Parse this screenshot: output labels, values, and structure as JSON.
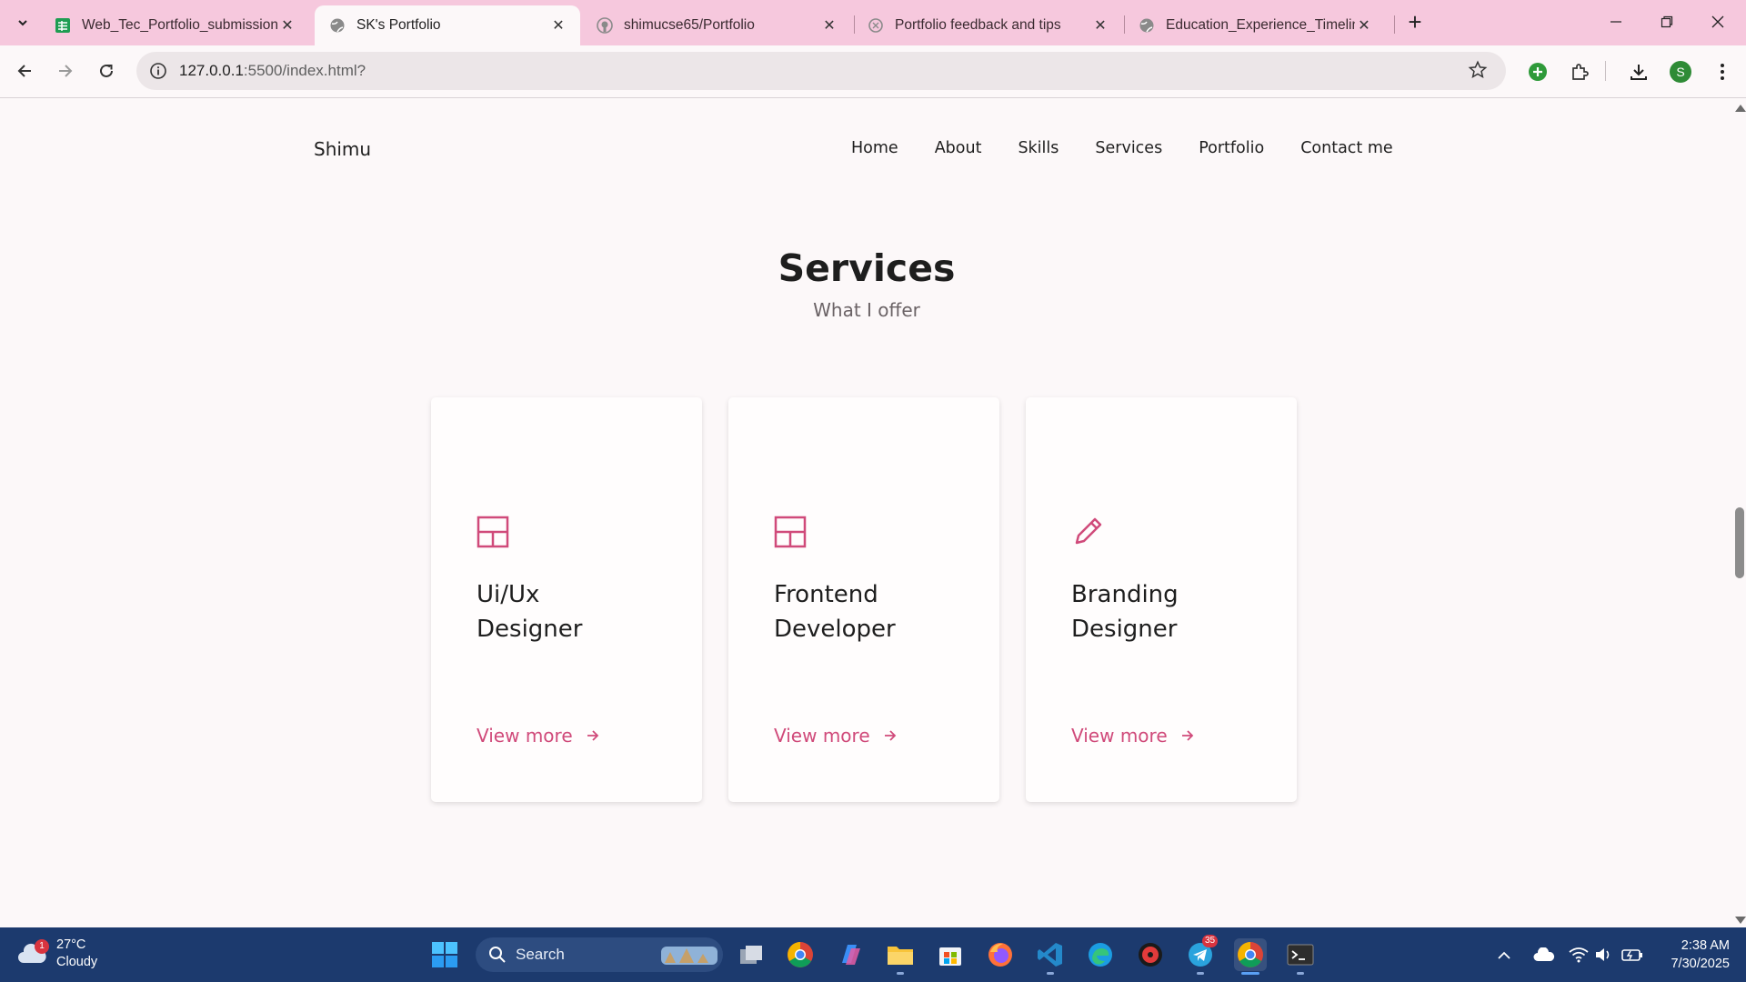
{
  "browser": {
    "tabs": [
      {
        "title": "Web_Tec_Portfolio_submission",
        "icon": "sheets-icon",
        "active": false
      },
      {
        "title": "SK's Portfolio",
        "icon": "globe-icon",
        "active": true
      },
      {
        "title": "shimucse65/Portfolio",
        "icon": "github-icon",
        "active": false
      },
      {
        "title": "Portfolio feedback and tips",
        "icon": "chatgpt-icon",
        "active": false
      },
      {
        "title": "Education_Experience_Timeline",
        "icon": "globe-icon",
        "active": false
      }
    ],
    "new_tab_label": "+",
    "url_host": "127.0.0.1",
    "url_rest": ":5500/index.html?",
    "profile_initial": "S"
  },
  "page": {
    "logo": "Shimu",
    "nav": [
      "Home",
      "About",
      "Skills",
      "Services",
      "Portfolio",
      "Contact me"
    ],
    "section_title": "Services",
    "section_subtitle": "What I offer",
    "services": [
      {
        "line1": "Ui/Ux",
        "line2": "Designer",
        "icon": "layout-icon",
        "more": "View more"
      },
      {
        "line1": "Frontend",
        "line2": "Developer",
        "icon": "layout-icon",
        "more": "View more"
      },
      {
        "line1": "Branding",
        "line2": "Designer",
        "icon": "pencil-icon",
        "more": "View more"
      }
    ],
    "accent_color": "#d04a7a"
  },
  "taskbar": {
    "weather_temp": "27°C",
    "weather_desc": "Cloudy",
    "weather_badge": "1",
    "search_label": "Search",
    "telegram_badge": "35",
    "time": "2:38 AM",
    "date": "7/30/2025"
  }
}
